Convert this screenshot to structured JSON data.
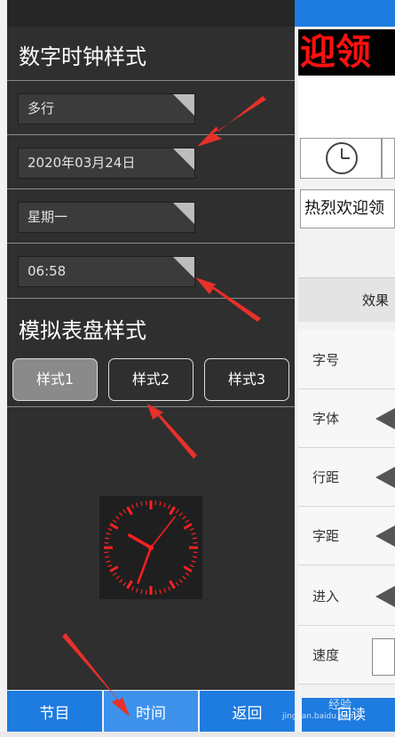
{
  "background_app": {
    "led_text": "迎领",
    "text_input_value": "热烈欢迎领",
    "effect_tab_label": "效果",
    "rows": [
      {
        "label": "字号"
      },
      {
        "label": "字体"
      },
      {
        "label": "行距"
      },
      {
        "label": "字距"
      },
      {
        "label": "进入"
      },
      {
        "label": "速度"
      }
    ],
    "bottom_button_label": "回读"
  },
  "digital_clock": {
    "title": "数字时钟样式",
    "options": [
      "多行",
      "2020年03月24日",
      "星期一",
      "06:58"
    ]
  },
  "analog_clock": {
    "title": "模拟表盘样式",
    "styles": [
      "样式1",
      "样式2",
      "样式3"
    ],
    "selected_style": "样式1"
  },
  "bottom_nav": {
    "items": [
      "节目",
      "时间",
      "返回"
    ],
    "active": "时间"
  },
  "watermark": {
    "line1": "经验",
    "line2": "jingyan.baidu.com"
  },
  "colors": {
    "accent_blue": "#1e7be0",
    "drawer_bg": "#2f2f2f",
    "clock_red": "#ff2020",
    "annotation_red": "#e8302a"
  }
}
